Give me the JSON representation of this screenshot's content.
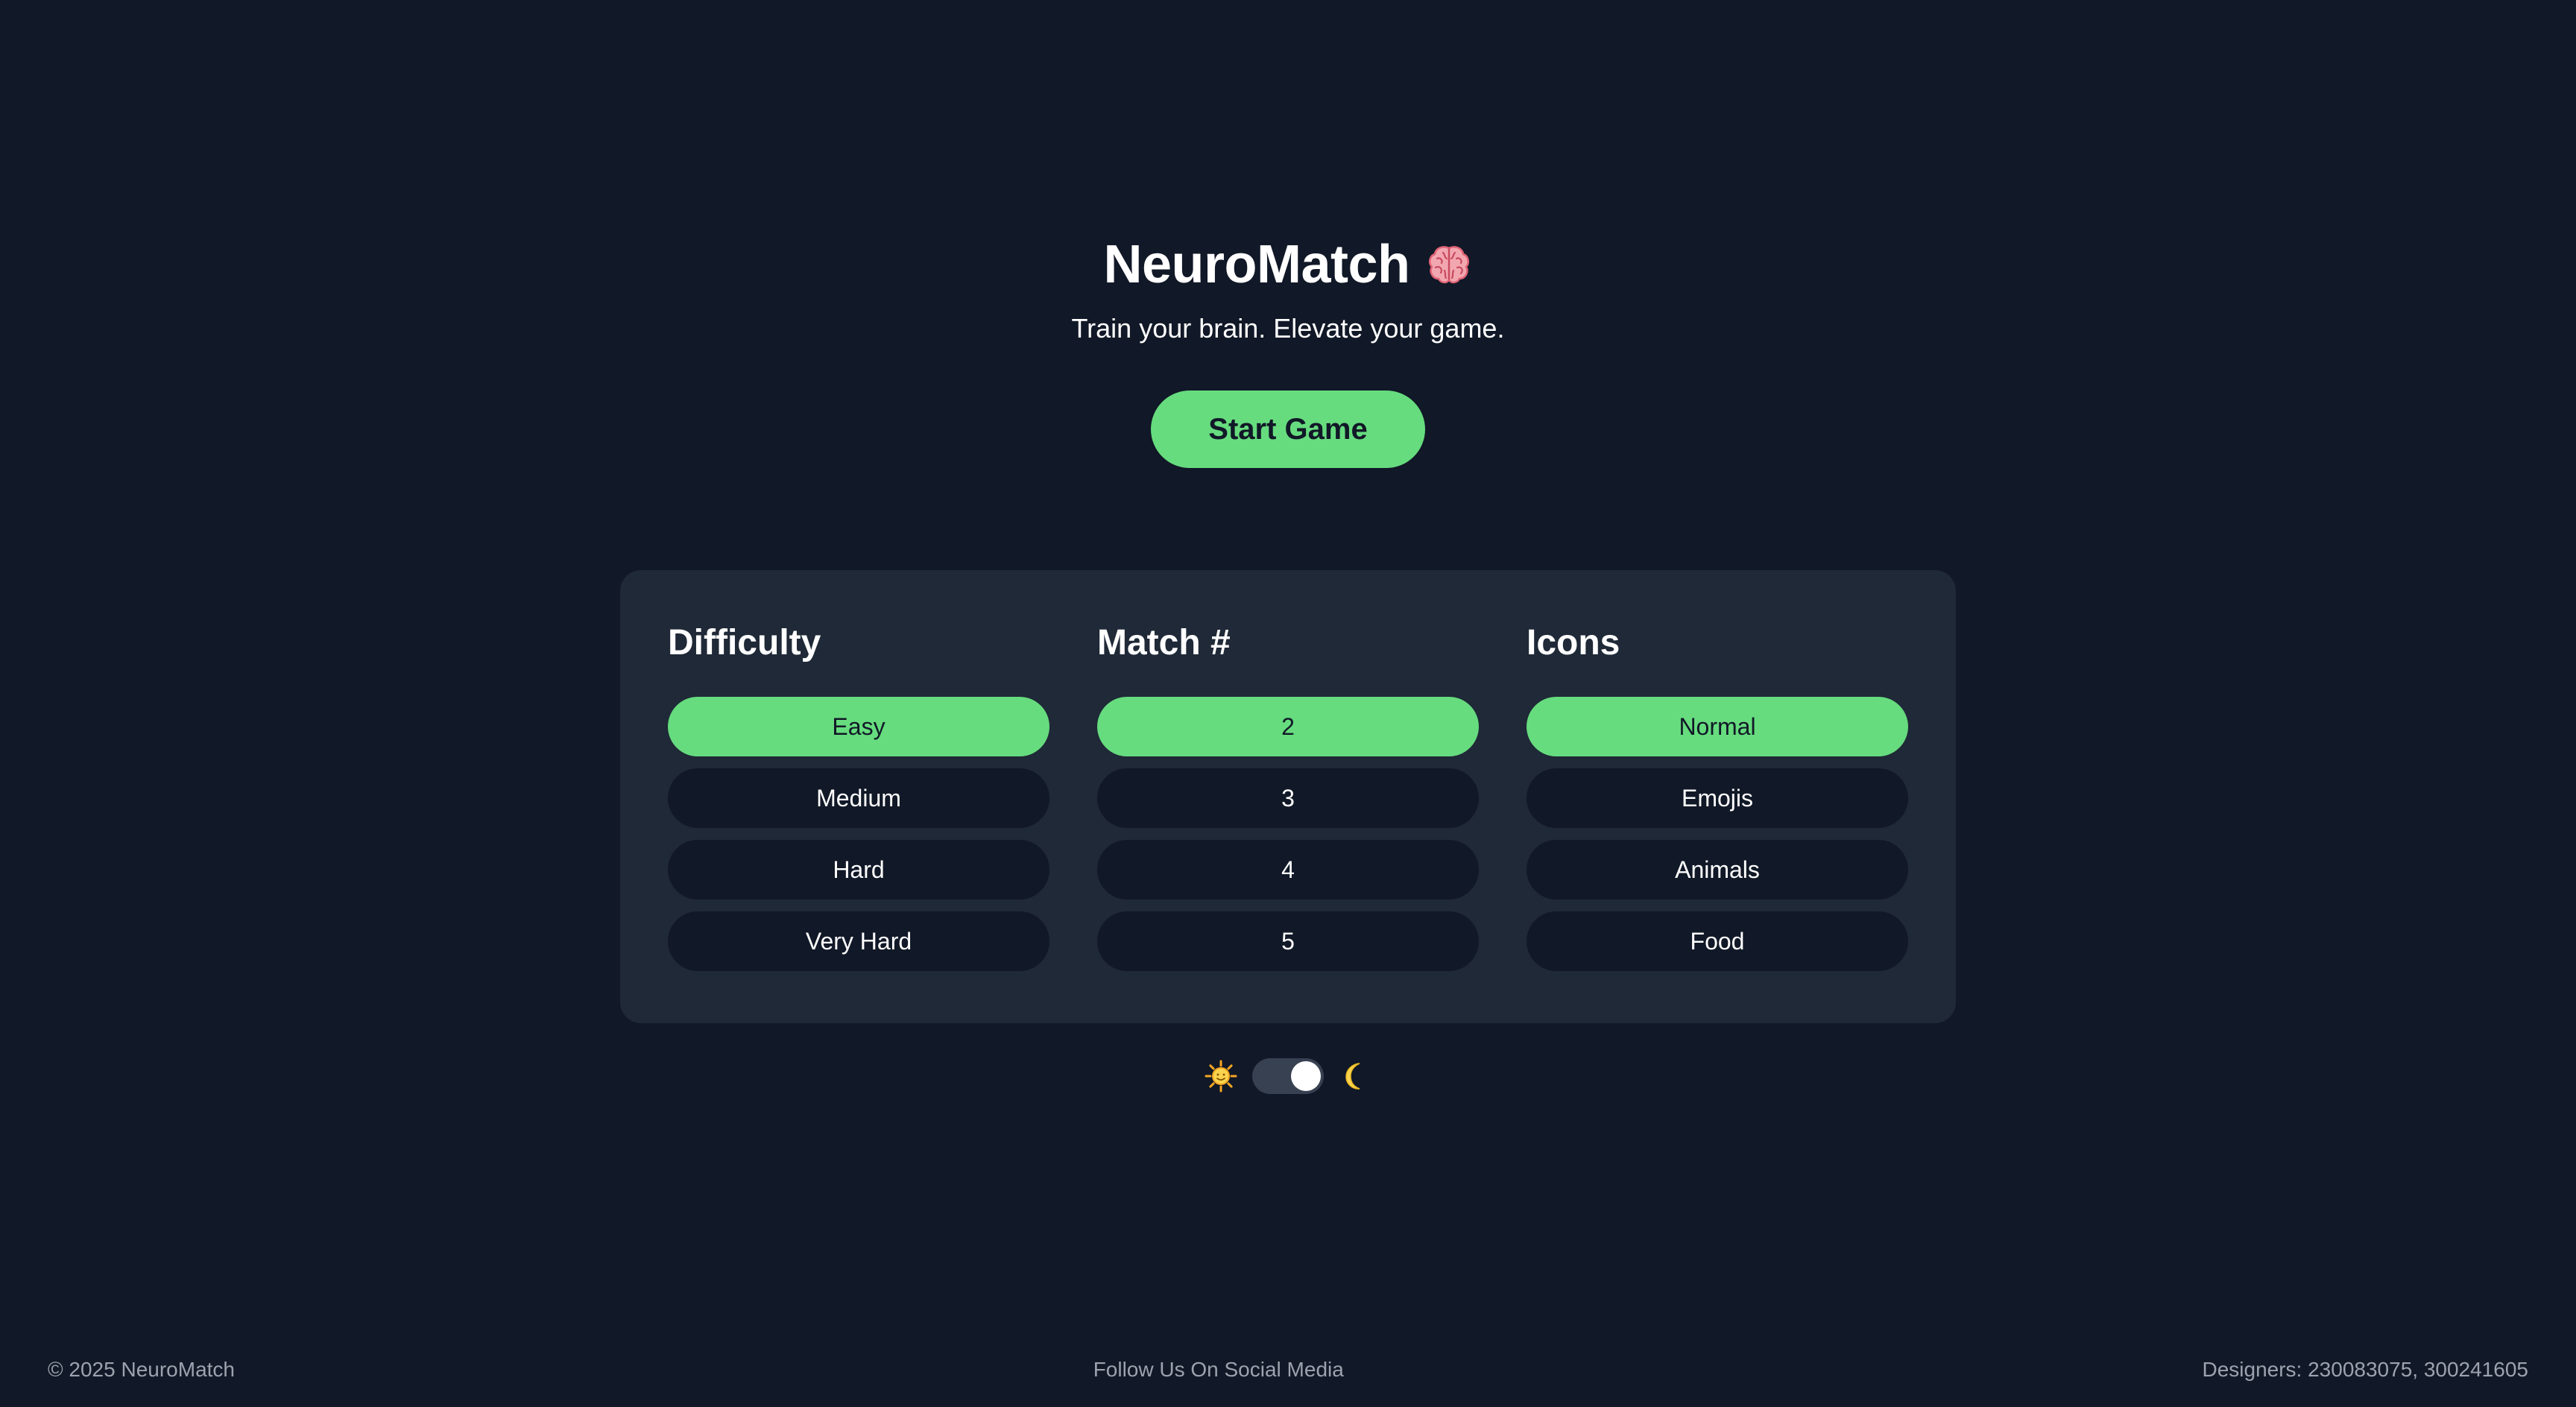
{
  "header": {
    "title": "NeuroMatch",
    "title_icon": "brain-icon",
    "tagline": "Train your brain. Elevate your game.",
    "start_label": "Start Game"
  },
  "settings": {
    "difficulty": {
      "title": "Difficulty",
      "options": [
        "Easy",
        "Medium",
        "Hard",
        "Very Hard"
      ],
      "selected": "Easy"
    },
    "match": {
      "title": "Match #",
      "options": [
        "2",
        "3",
        "4",
        "5"
      ],
      "selected": "2"
    },
    "icons": {
      "title": "Icons",
      "options": [
        "Normal",
        "Emojis",
        "Animals",
        "Food"
      ],
      "selected": "Normal"
    }
  },
  "theme_toggle": {
    "left_icon": "sun-icon",
    "right_icon": "moon-icon",
    "state": "dark"
  },
  "footer": {
    "copyright": "© 2025 NeuroMatch",
    "social": "Follow Us On Social Media",
    "designers": "Designers: 230083075, 300241605"
  },
  "colors": {
    "background": "#111827",
    "panel": "#1f2937",
    "accent": "#66dc7e",
    "muted_text": "#9ca3af"
  }
}
